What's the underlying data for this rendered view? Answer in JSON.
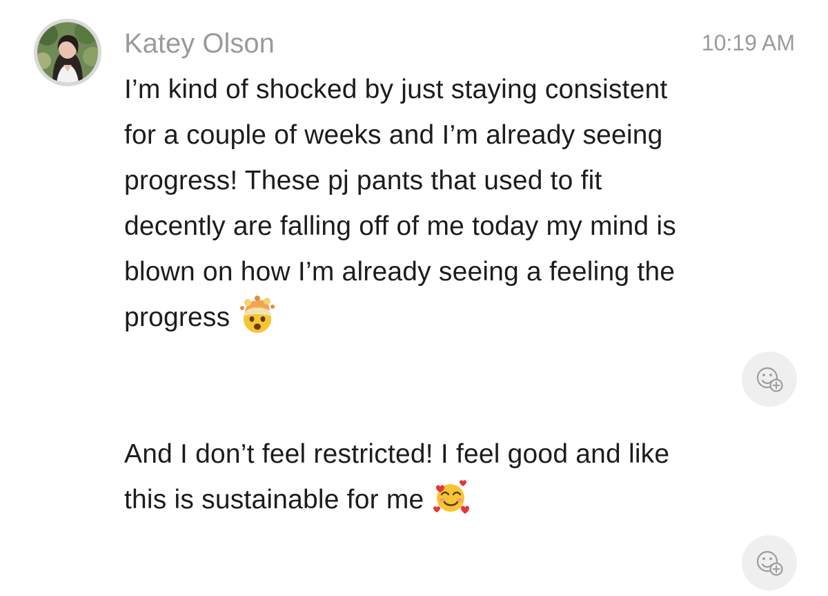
{
  "message": {
    "sender_name": "Katey Olson",
    "timestamp": "10:19 AM",
    "avatar_icon": "profile-photo-avatar",
    "paragraph_1": {
      "lines": [
        "I’m kind of shocked by just staying consistent",
        "for a couple of weeks and I’m already seeing",
        "progress! These pj pants that used to fit",
        "decently are falling off of me today my mind is",
        "blown on how I’m already seeing a feeling the",
        "progress"
      ],
      "trailing_emoji": "exploding-head-emoji"
    },
    "paragraph_2": {
      "lines": [
        "And I don’t feel restricted! I feel good and like",
        "this is sustainable for me"
      ],
      "trailing_emoji": "smiling-face-with-hearts-emoji"
    },
    "reaction_button_icon": "add-reaction-icon"
  },
  "colors": {
    "meta_text": "#9a9a9a",
    "body_text": "#1c1c1c",
    "reaction_bg": "#efefef"
  }
}
